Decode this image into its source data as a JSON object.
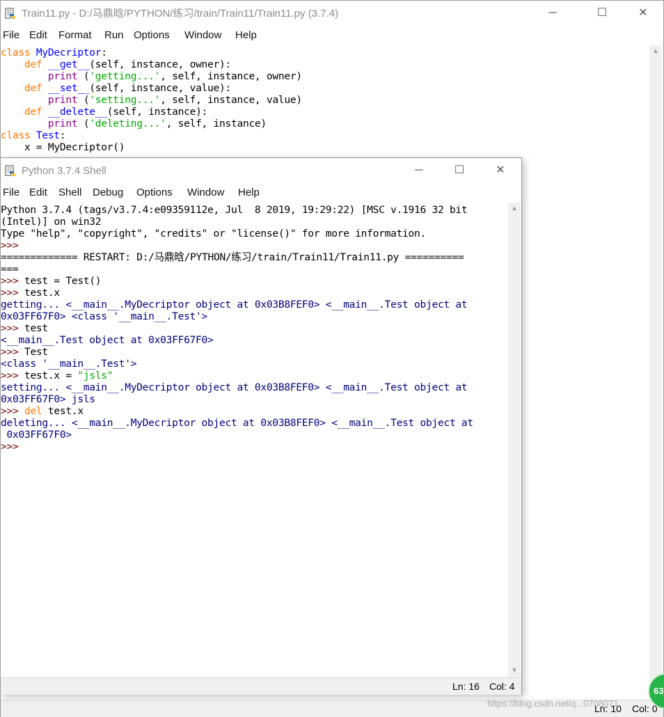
{
  "editor": {
    "title": "Train11.py - D:/马鼎晗/PYTHON/练习/train/Train11/Train11.py (3.7.4)",
    "menu": [
      "File",
      "Edit",
      "Format",
      "Run",
      "Options",
      "Window",
      "Help"
    ],
    "code_lines": [
      [
        [
          "kw",
          "class "
        ],
        [
          "df",
          "MyDecriptor"
        ],
        [
          "plain",
          ":"
        ]
      ],
      [
        [
          "plain",
          "    "
        ],
        [
          "kw",
          "def "
        ],
        [
          "df",
          "__get__"
        ],
        [
          "plain",
          "(self, instance, owner):"
        ]
      ],
      [
        [
          "plain",
          "        "
        ],
        [
          "bi",
          "print "
        ],
        [
          "plain",
          "("
        ],
        [
          "str",
          "'getting...'"
        ],
        [
          "plain",
          ", self, instance, owner)"
        ]
      ],
      [
        [
          "plain",
          "    "
        ],
        [
          "kw",
          "def "
        ],
        [
          "df",
          "__set__"
        ],
        [
          "plain",
          "(self, instance, value):"
        ]
      ],
      [
        [
          "plain",
          "        "
        ],
        [
          "bi",
          "print "
        ],
        [
          "plain",
          "("
        ],
        [
          "str",
          "'setting...'"
        ],
        [
          "plain",
          ", self, instance, value)"
        ]
      ],
      [
        [
          "plain",
          "    "
        ],
        [
          "kw",
          "def "
        ],
        [
          "df",
          "__delete__"
        ],
        [
          "plain",
          "(self, instance):"
        ]
      ],
      [
        [
          "plain",
          "        "
        ],
        [
          "bi",
          "print "
        ],
        [
          "plain",
          "("
        ],
        [
          "str",
          "'deleting...'"
        ],
        [
          "plain",
          ", self, instance)"
        ]
      ],
      [
        [
          "kw",
          "class "
        ],
        [
          "df",
          "Test"
        ],
        [
          "plain",
          ":"
        ]
      ],
      [
        [
          "plain",
          "    x = MyDecriptor()"
        ]
      ]
    ],
    "status": {
      "ln": "Ln: 10",
      "col": "Col: 0"
    }
  },
  "shell": {
    "title": "Python 3.7.4 Shell",
    "menu": [
      "File",
      "Edit",
      "Shell",
      "Debug",
      "Options",
      "Window",
      "Help"
    ],
    "lines": [
      [
        [
          "plain",
          "Python 3.7.4 (tags/v3.7.4:e09359112e, Jul  8 2019, 19:29:22) [MSC v.1916 32 bit"
        ]
      ],
      [
        [
          "plain",
          "(Intel)] on win32"
        ]
      ],
      [
        [
          "plain",
          "Type \"help\", \"copyright\", \"credits\" or \"license()\" for more information."
        ]
      ],
      [
        [
          "prompt",
          ">>> "
        ]
      ],
      [
        [
          "plain",
          "============= RESTART: D:/马鼎晗/PYTHON/练习/train/Train11/Train11.py =========="
        ]
      ],
      [
        [
          "plain",
          "==="
        ]
      ],
      [
        [
          "prompt",
          ">>> "
        ],
        [
          "plain",
          "test = Test()"
        ]
      ],
      [
        [
          "prompt",
          ">>> "
        ],
        [
          "plain",
          "test.x"
        ]
      ],
      [
        [
          "out",
          "getting... <__main__.MyDecriptor object at 0x03B8FEF0> <__main__.Test object at"
        ]
      ],
      [
        [
          "out",
          "0x03FF67F0> <class '__main__.Test'>"
        ]
      ],
      [
        [
          "prompt",
          ">>> "
        ],
        [
          "plain",
          "test"
        ]
      ],
      [
        [
          "out",
          "<__main__.Test object at 0x03FF67F0>"
        ]
      ],
      [
        [
          "prompt",
          ">>> "
        ],
        [
          "plain",
          "Test"
        ]
      ],
      [
        [
          "out",
          "<class '__main__.Test'>"
        ]
      ],
      [
        [
          "prompt",
          ">>> "
        ],
        [
          "plain",
          "test.x = "
        ],
        [
          "str",
          "\"jsls\""
        ]
      ],
      [
        [
          "out",
          "setting... <__main__.MyDecriptor object at 0x03B8FEF0> <__main__.Test object at"
        ]
      ],
      [
        [
          "out",
          "0x03FF67F0> jsls"
        ]
      ],
      [
        [
          "prompt",
          ">>> "
        ],
        [
          "kw",
          "del "
        ],
        [
          "plain",
          "test.x"
        ]
      ],
      [
        [
          "out",
          "deleting... <__main__.MyDecriptor object at 0x03B8FEF0> <__main__.Test object at"
        ]
      ],
      [
        [
          "out",
          " 0x03FF67F0>"
        ]
      ],
      [
        [
          "prompt",
          ">>> "
        ]
      ]
    ],
    "status": {
      "ln": "Ln: 16",
      "col": "Col: 4"
    }
  },
  "window_controls": {
    "minimize": "─",
    "maximize": "☐",
    "close": "✕"
  },
  "overlay": {
    "watermark": "https://blog.csdn.net/q...0708071",
    "badge": "63"
  },
  "colors": {
    "keyword": "#ff7700",
    "builtin": "#900090",
    "string": "#00aa00",
    "definition": "#0000ff",
    "output": "#000080",
    "prompt": "#770000"
  },
  "icons": {
    "app": "python-idle-icon",
    "scroll_up": "chevron-up-icon",
    "scroll_down": "chevron-down-icon"
  }
}
